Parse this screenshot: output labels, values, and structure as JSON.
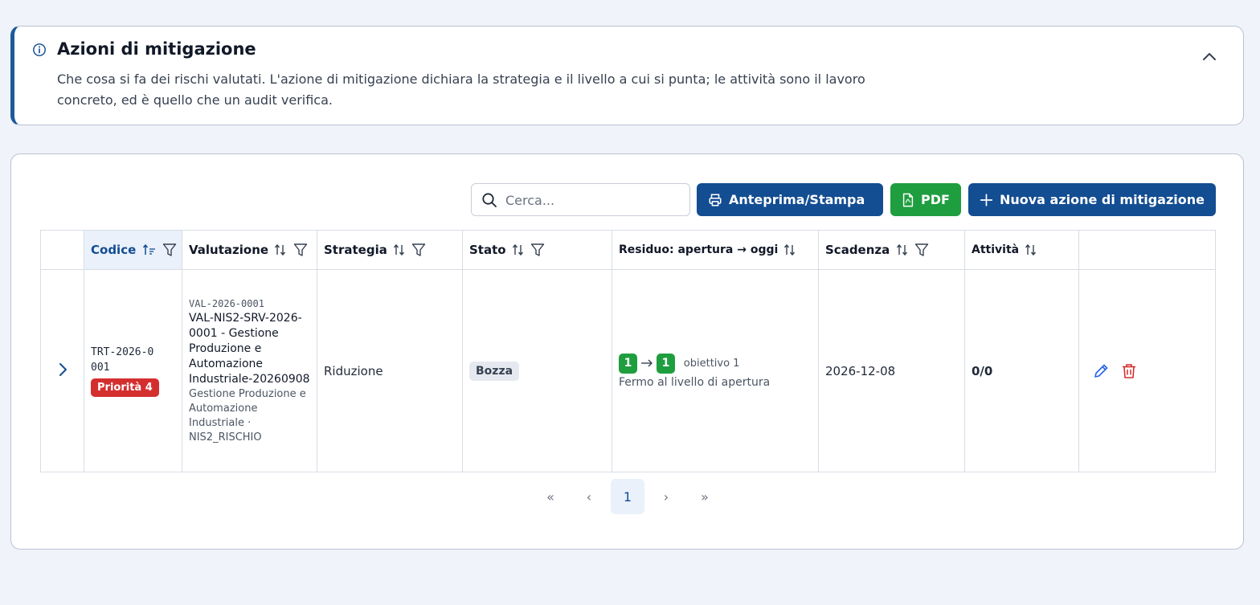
{
  "info": {
    "title": "Azioni di mitigazione",
    "description": "Che cosa si fa dei rischi valutati. L'azione di mitigazione dichiara la strategia e il livello a cui si punta; le attività sono il lavoro concreto, ed è quello che un audit verifica.",
    "icon": "info-icon",
    "collapse_icon": "chevron-up-icon"
  },
  "toolbar": {
    "search_placeholder": "Cerca...",
    "print_label": "Anteprima/Stampa",
    "pdf_label": "PDF",
    "new_label": "Nuova azione di mitigazione"
  },
  "columns": {
    "codice": "Codice",
    "valutazione": "Valutazione",
    "strategia": "Strategia",
    "stato": "Stato",
    "residuo": "Residuo: apertura → oggi",
    "scadenza": "Scadenza",
    "attivita": "Attività"
  },
  "rows": [
    {
      "codice": "TRT-2026-0001",
      "priorita": "Priorità 4",
      "val_code": "VAL-2026-0001",
      "val_main": "VAL-NIS2-SRV-2026-0001 - Gestione Produzione e Automazione Industriale-20260908",
      "val_sub": "Gestione Produzione e Automazione Industriale · NIS2_RISCHIO",
      "strategia": "Riduzione",
      "stato": "Bozza",
      "residuo_apertura": "1",
      "residuo_oggi": "1",
      "obiettivo": "obiettivo 1",
      "residuo_note": "Fermo al livello di apertura",
      "scadenza": "2026-12-08",
      "attivita": "0/0"
    }
  ],
  "pagination": {
    "first": "«",
    "prev": "‹",
    "current": "1",
    "next": "›",
    "last": "»"
  },
  "colors": {
    "primary": "#134d92",
    "success": "#1f9e3f",
    "danger": "#d42f2f"
  }
}
